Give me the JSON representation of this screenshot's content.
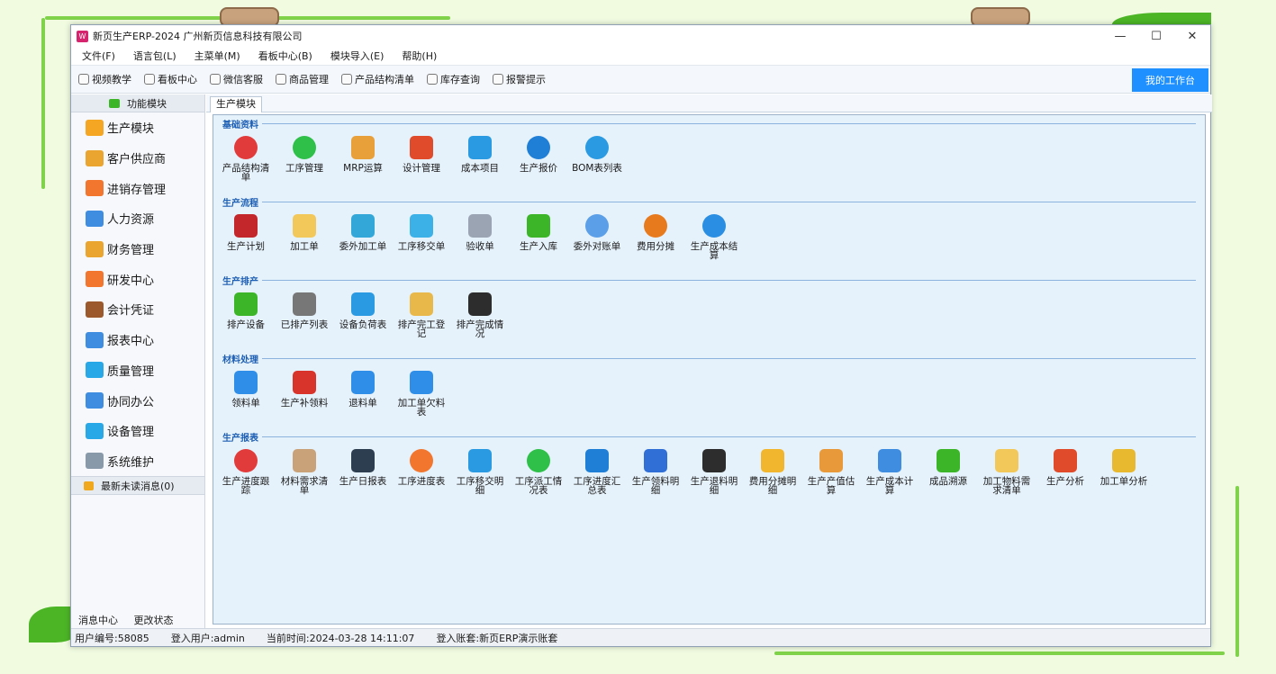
{
  "window": {
    "title": "新页生产ERP-2024 广州新页信息科技有限公司",
    "logo": "W"
  },
  "window_controls": {
    "minimize": "—",
    "maximize": "☐",
    "close": "✕"
  },
  "menu": [
    "文件(F)",
    "语言包(L)",
    "主菜单(M)",
    "看板中心(B)",
    "模块导入(E)",
    "帮助(H)"
  ],
  "toolbar": {
    "items": [
      "视频教学",
      "看板中心",
      "微信客服",
      "商品管理",
      "产品结构清单",
      "库存查询",
      "报警提示"
    ],
    "workbench": "我的工作台"
  },
  "sidebar": {
    "header": "功能模块",
    "items": [
      "生产模块",
      "客户供应商",
      "进销存管理",
      "人力资源",
      "财务管理",
      "研发中心",
      "会计凭证",
      "报表中心",
      "质量管理",
      "协同办公",
      "设备管理",
      "系统维护"
    ],
    "item_colors": [
      "#f5a623",
      "#e9a52f",
      "#f2762e",
      "#3e8de0",
      "#e9a52f",
      "#f2762e",
      "#9c5a2c",
      "#3e8de0",
      "#29a8e8",
      "#3e8de0",
      "#29a8e8",
      "#8899aa"
    ],
    "messages": "最新未读消息(0)",
    "bottom": [
      "消息中心",
      "更改状态"
    ]
  },
  "tab": "生产模块",
  "sections": [
    {
      "title": "基础资料",
      "items": [
        "产品结构清单",
        "工序管理",
        "MRP运算",
        "设计管理",
        "成本项目",
        "生产报价",
        "BOM表列表"
      ],
      "colors": [
        "#e23b3b",
        "#2fc04a",
        "#e8a03a",
        "#e04b2b",
        "#2a9be2",
        "#1f7fd6",
        "#2a9be2"
      ]
    },
    {
      "title": "生产流程",
      "items": [
        "生产计划",
        "加工单",
        "委外加工单",
        "工序移交单",
        "验收单",
        "生产入库",
        "委外对账单",
        "费用分摊",
        "生产成本结算"
      ],
      "colors": [
        "#c3262b",
        "#f3c85a",
        "#33a8d8",
        "#3bb1e8",
        "#9aa4b2",
        "#3cb528",
        "#5b9fe8",
        "#e87a1e",
        "#2a8fe2"
      ]
    },
    {
      "title": "生产排产",
      "items": [
        "排产设备",
        "已排产列表",
        "设备负荷表",
        "排产完工登记",
        "排产完成情况"
      ],
      "colors": [
        "#3cb528",
        "#777777",
        "#2a9be2",
        "#e8b84a",
        "#2d2d2d"
      ]
    },
    {
      "title": "材料处理",
      "items": [
        "领料单",
        "生产补领料",
        "退料单",
        "加工单欠料表"
      ],
      "colors": [
        "#2f8ee8",
        "#d9342b",
        "#2f8ee8",
        "#2f8ee8"
      ]
    },
    {
      "title": "生产报表",
      "items": [
        "生产进度跟踪",
        "材料需求清单",
        "生产日报表",
        "工序进度表",
        "工序移交明细",
        "工序派工情况表",
        "工序进度汇总表",
        "生产领料明细",
        "生产退料明细",
        "费用分摊明细",
        "生产产值估算",
        "生产成本计算",
        "成品溯源",
        "加工物料需求清单",
        "生产分析",
        "加工单分析"
      ],
      "colors": [
        "#e23b3b",
        "#c9a27a",
        "#2c3e50",
        "#f2762e",
        "#2a9be2",
        "#2fc04a",
        "#1f7fd6",
        "#2f6fd6",
        "#2d2d2d",
        "#f2b62e",
        "#e89a3a",
        "#3e8de0",
        "#3cb528",
        "#f3c85a",
        "#e04b2b",
        "#e8b82e"
      ]
    }
  ],
  "status": {
    "user_no": "用户编号:58085",
    "user": "登入用户:admin",
    "time": "当前时间:2024-03-28 14:11:07",
    "account": "登入账套:新页ERP演示账套"
  }
}
